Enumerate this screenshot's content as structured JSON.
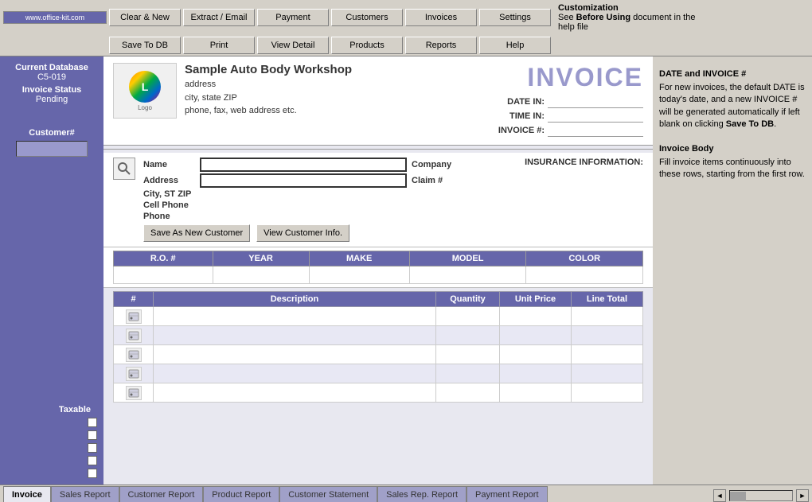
{
  "site": {
    "url": "www.office-kit.com"
  },
  "toolbar": {
    "row1": {
      "btn1": "Clear & New",
      "btn2": "Extract / Email",
      "btn3": "Payment",
      "btn4": "Customers",
      "btn5": "Invoices",
      "btn6": "Settings"
    },
    "row2": {
      "btn1": "Save To DB",
      "btn2": "Print",
      "btn3": "View Detail",
      "btn4": "Products",
      "btn5": "Reports",
      "btn6": "Help"
    }
  },
  "help_panel_top": {
    "title": "Customization",
    "text": "See ",
    "bold": "Before Using",
    "text2": " document in the help file"
  },
  "sidebar": {
    "current_db_label": "Current Database",
    "current_db_value": "C5-019",
    "invoice_status_label": "Invoice Status",
    "invoice_status_value": "Pending",
    "customer_label": "Customer#",
    "taxable_label": "Taxable"
  },
  "invoice_header": {
    "company_name": "Sample Auto Body Workshop",
    "address": "address",
    "city_state": "city, state ZIP",
    "phone": "phone, fax, web address etc.",
    "invoice_title": "INVOICE",
    "date_in_label": "DATE IN:",
    "time_in_label": "TIME IN:",
    "invoice_num_label": "INVOICE #:"
  },
  "customer_section": {
    "insurance_title": "INSURANCE INFORMATION:",
    "name_label": "Name",
    "company_label": "Company",
    "address_label": "Address",
    "claim_label": "Claim #",
    "city_label": "City, ST ZIP",
    "cell_label": "Cell Phone",
    "phone_label": "Phone",
    "btn_save": "Save As New Customer",
    "btn_view": "View Customer Info."
  },
  "vehicle_table": {
    "headers": [
      "R.O. #",
      "YEAR",
      "MAKE",
      "MODEL",
      "COLOR"
    ]
  },
  "invoice_table": {
    "headers": [
      "#",
      "Description",
      "Quantity",
      "Unit Price",
      "Line Total"
    ],
    "rows": [
      {
        "num": "",
        "desc": "",
        "qty": "",
        "price": "",
        "total": ""
      },
      {
        "num": "",
        "desc": "",
        "qty": "",
        "price": "",
        "total": ""
      },
      {
        "num": "",
        "desc": "",
        "qty": "",
        "price": "",
        "total": ""
      },
      {
        "num": "",
        "desc": "",
        "qty": "",
        "price": "",
        "total": ""
      },
      {
        "num": "",
        "desc": "",
        "qty": "",
        "price": "",
        "total": ""
      }
    ]
  },
  "help_panel_right": {
    "date_section_title": "DATE and INVOICE #",
    "date_section_text": "For new invoices, the default DATE is today's date, and a new INVOICE # will be generated automatically if left blank  on clicking ",
    "date_section_bold": "Save To DB",
    "date_section_end": ".",
    "body_section_title": "Invoice Body",
    "body_section_text": "Fill invoice items continuously into these rows, starting from the first row."
  },
  "bottom_tabs": {
    "tabs": [
      "Invoice",
      "Sales Report",
      "Customer Report",
      "Product Report",
      "Customer Statement",
      "Sales Rep. Report",
      "Payment Report"
    ],
    "active": "Invoice"
  }
}
